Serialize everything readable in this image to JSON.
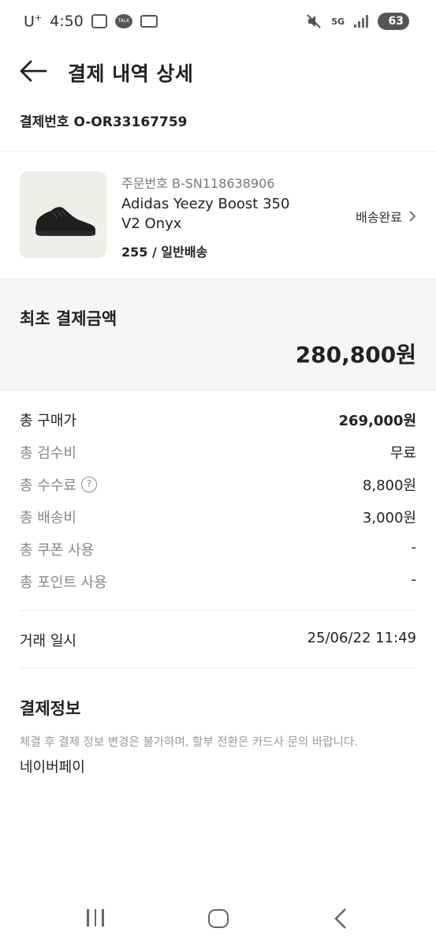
{
  "status_bar": {
    "carrier": "U",
    "carrier_sup": "+",
    "time": "4:50",
    "network": "5G",
    "battery": "63",
    "icons": [
      "screenshot-icon",
      "kakaotalk-icon",
      "voicemail-icon",
      "mute-icon",
      "signal-icon",
      "battery-icon"
    ]
  },
  "header": {
    "title": "결제 내역 상세",
    "back_icon": "arrow-left-icon"
  },
  "order": {
    "payment_no": "결제번호 O-OR33167759"
  },
  "product": {
    "order_no": "주문번호 B-SN118638906",
    "name": "Adidas Yeezy Boost 350 V2 Onyx",
    "option": "255 / 일반배송",
    "status": "배송완료",
    "image": "black-sneaker-image"
  },
  "total": {
    "label": "최초 결제금액",
    "value": "280,800원"
  },
  "breakdown": [
    {
      "label": "총 구매가",
      "value": "269,000원"
    },
    {
      "label": "총 검수비",
      "value": "무료"
    },
    {
      "label": "총 수수료",
      "value": "8,800원",
      "help": "?"
    },
    {
      "label": "총 배송비",
      "value": "3,000원"
    },
    {
      "label": "총 쿠폰 사용",
      "value": "-"
    },
    {
      "label": "총 포인트 사용",
      "value": "-"
    }
  ],
  "trade": {
    "label": "거래 일시",
    "value": "25/06/22 11:49"
  },
  "payment_info": {
    "title": "결제정보",
    "note": "체결 후 결제 정보 변경은 불가하며, 할부 전환은 카드사 문의 바랍니다.",
    "method": "네이버페이"
  },
  "colors": {
    "text": "#222222",
    "muted": "#888888",
    "panel": "#f6f6f6",
    "divider": "#ebebeb"
  }
}
